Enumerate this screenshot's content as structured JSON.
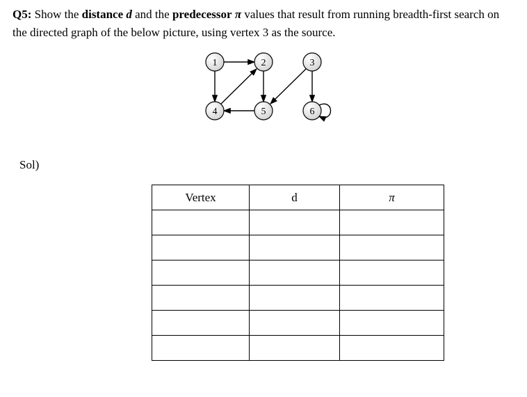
{
  "question": {
    "label": "Q5:",
    "text_part1": " Show the ",
    "term_distance": "distance",
    "term_d": " d",
    "text_part2": " and the ",
    "term_predecessor": "predecessor",
    "term_pi": " π",
    "text_part3": " values that result from running breadth-first search on the directed graph of the below picture, using vertex 3 as the source."
  },
  "graph": {
    "nodes": [
      {
        "id": "1",
        "label": "1"
      },
      {
        "id": "2",
        "label": "2"
      },
      {
        "id": "3",
        "label": "3"
      },
      {
        "id": "4",
        "label": "4"
      },
      {
        "id": "5",
        "label": "5"
      },
      {
        "id": "6",
        "label": "6"
      }
    ],
    "edges": [
      [
        "1",
        "2"
      ],
      [
        "1",
        "4"
      ],
      [
        "2",
        "5"
      ],
      [
        "4",
        "2"
      ],
      [
        "5",
        "4"
      ],
      [
        "3",
        "5"
      ],
      [
        "3",
        "6"
      ],
      [
        "6",
        "6"
      ]
    ]
  },
  "sol_label": "Sol)",
  "table": {
    "headers": {
      "vertex": "Vertex",
      "d": "d",
      "pi": "π"
    },
    "rows": [
      {
        "vertex": "",
        "d": "",
        "pi": ""
      },
      {
        "vertex": "",
        "d": "",
        "pi": ""
      },
      {
        "vertex": "",
        "d": "",
        "pi": ""
      },
      {
        "vertex": "",
        "d": "",
        "pi": ""
      },
      {
        "vertex": "",
        "d": "",
        "pi": ""
      },
      {
        "vertex": "",
        "d": "",
        "pi": ""
      }
    ]
  }
}
